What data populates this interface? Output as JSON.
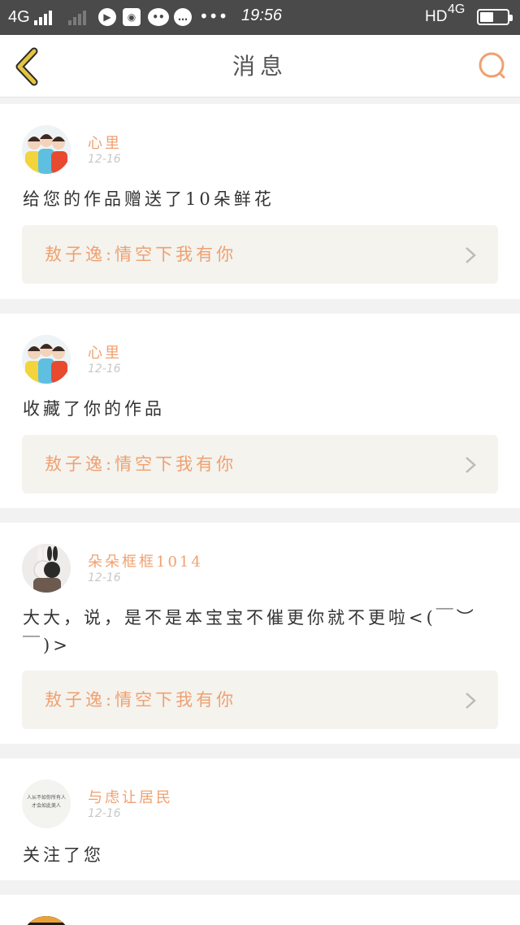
{
  "status_bar": {
    "carrier": "4G",
    "time": "19:56",
    "hd": "HD",
    "network": "4G",
    "icons": [
      "play-icon",
      "browser-icon",
      "wechat-icon",
      "chat-icon",
      "more-dots-icon"
    ]
  },
  "header": {
    "title": "消息",
    "back_icon": "chevron-left-icon",
    "search_icon": "search-icon",
    "accent_color": "#f0a070",
    "back_color": "#c9a21a"
  },
  "messages": [
    {
      "username": "心里",
      "date": "12-16",
      "text": "给您的作品赠送了10朵鲜花",
      "work": "敖子逸:情空下我有你"
    },
    {
      "username": "心里",
      "date": "12-16",
      "text": "收藏了你的作品",
      "work": "敖子逸:情空下我有你"
    },
    {
      "username": "朵朵框框1014",
      "date": "12-16",
      "text": "大大，说，是不是本宝宝不催更你就不更啦<(￣︶￣)>",
      "work": "敖子逸:情空下我有你"
    },
    {
      "username": "与虑让居民",
      "date": "12-16",
      "text": "关注了您",
      "avatar_text": "人从不如你所有人 才会如此美人"
    }
  ]
}
